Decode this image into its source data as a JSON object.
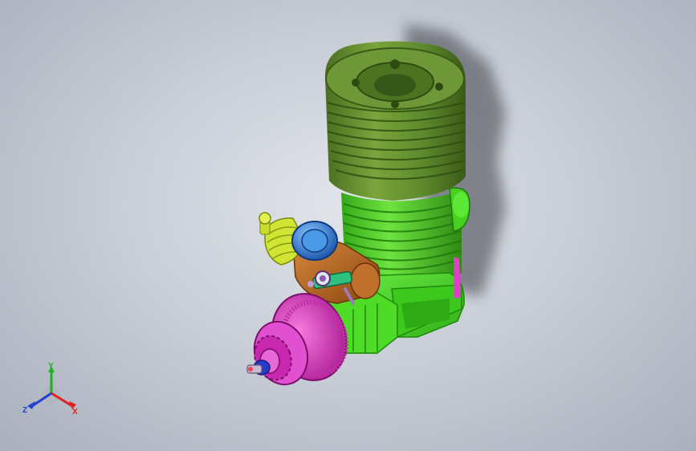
{
  "triad": {
    "x_label": "X",
    "y_label": "Y",
    "z_label": "Z",
    "x_color": "#e02020",
    "y_color": "#20b020",
    "z_color": "#2040d0"
  },
  "colors": {
    "background": "#c9ced7",
    "cylinder_head": "#5e8a2a",
    "cylinder_barrel": "#58d62a",
    "crankcase": "#4ee02a",
    "carburetor": "#b86420",
    "fuel_fitting": "#d4e840",
    "intake_ring": "#2a78d8",
    "drive_hub": "#e040c8",
    "needle_valve": "#30c080"
  },
  "model": {
    "name_icon": "rc-nitro-engine-model"
  }
}
